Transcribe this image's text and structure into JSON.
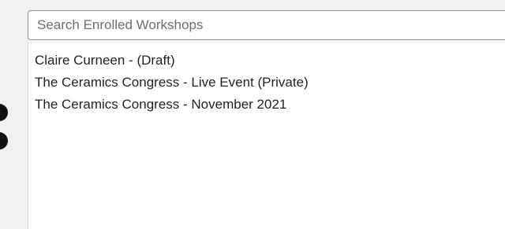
{
  "search": {
    "placeholder": "Search Enrolled Workshops",
    "value": ""
  },
  "results": [
    {
      "label": "Claire Curneen - (Draft)"
    },
    {
      "label": "The Ceramics Congress - Live Event (Private)"
    },
    {
      "label": "The Ceramics Congress - November 2021"
    }
  ]
}
